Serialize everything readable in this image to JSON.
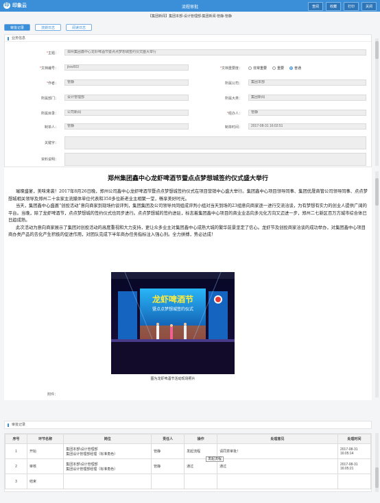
{
  "app": {
    "logo_text": "印象云",
    "logo_mark": "印",
    "window_title": "流程审批"
  },
  "top_actions": [
    "查阅",
    "收藏",
    "打印",
    "关闭"
  ],
  "doc_header": "【集团新闻】集团本部-设计管理部-集团新闻-管静-管静",
  "tabs": [
    "审批记录",
    "流转日志",
    "阅读日志"
  ],
  "business_info": {
    "title": "业务信息",
    "fields": {
      "subject_label": "主题：",
      "subject": "郑州集团鑫中心龙虾啤酒节暨点点梦想城签约仪式盛大举行",
      "doc_no_label": "文档编号：",
      "doc_no": "jtxw003",
      "importance_label": "文档重要度：",
      "importance_options": [
        "非常重要",
        "重要",
        "普通"
      ],
      "importance_selected": 2,
      "author_label": "作者：",
      "author": "管静",
      "company_label": "所属公司：",
      "company": "集团本部",
      "dept_label": "所属部门：",
      "dept": "设计管理部",
      "center_label": "所属大类：",
      "center": "集团新闻",
      "category_label": "所属目录：",
      "category": "公司新闻",
      "handler_label": "经办人：",
      "handler": "管静",
      "editor_label": "制单人：",
      "editor": "管静",
      "time_label": "制单时间：",
      "time": "2017-08-31 16:02:51",
      "keywords_label": "关键字：",
      "summary_label": "资料说明：",
      "attachment_label": "附件："
    }
  },
  "article": {
    "title": "郑州集团鑫中心龙虾啤酒节暨点点梦想城签约仪式盛大举行",
    "paragraphs": [
      "璀璨盛宴，美味来袭！2017年8月26日晚，郑州公司鑫中心龙虾啤酒节暨点点梦想城签约仪式在项目营销中心盛大举行。集团鑫中心项目领导同事、集团优晟商管公司领导同事、点点梦想城相关领导及郑州二十余家主流媒体单位代表和350多位新老业主相聚一堂，畅享美好时光。",
      "当天，集团鑫中心盛邀“创投活动”意向商家到现场约谈评判，集团集团及公司领导共同组成评判小组对当天到场的23组意向商家逐一进行交流洽谈，为有梦想有实力的创业人提供广阔的平台。当晚，除了龙虾啤酒节，点点梦想城的签约仪式也同步进行。点点梦想城的签约进驻，标志着集团鑫中心项目的商业业态向多元化方向又迈进一步，郑州二七新区百万方城市综合体已日趋成熟。",
      "此次活动为意向商家展示了集团对创投活动的高度重视和大力支持，更让众多业主对集团鑫中心成熟大城的繁华前景坚定了信心。龙虾节及创投商家洽谈的成功举办，对集团鑫中心项目商办类产品的去化产生积极的促进作用，对团队完成下半年商办任务指标注入强心剂。全力拼搏，势必达成！"
    ],
    "photo_sign": "龙虾啤酒节",
    "photo_sub": "暨点点梦想城签约仪式",
    "caption": "图为龙虾啤酒节活动现场照片"
  },
  "records": {
    "title": "审批记录",
    "columns": [
      "序号",
      "环节名称",
      "岗位",
      "责任人",
      "操作",
      "处理意见",
      "处理时间"
    ],
    "rows": [
      {
        "no": "1",
        "step": "开始",
        "post1": "集团本部\\设计管理部",
        "post2": "集团设计管理部经理（标准角色）",
        "person": "管静",
        "action": "发起流程",
        "opinion": "请同意审批！",
        "date": "2017-08-31",
        "time": "16:05:14"
      },
      {
        "no": "2",
        "step": "审核",
        "post1": "集团本部\\设计管理部",
        "post2": "集团设计管理部经理（标准角色）",
        "person": "管静",
        "action": "通过",
        "opinion": "通过",
        "date": "2017-08-31",
        "time": "16:05:21"
      },
      {
        "no": "3",
        "step": "结束",
        "post1": "",
        "post2": "",
        "person": "",
        "action": "",
        "opinion": "",
        "date": "",
        "time": ""
      }
    ],
    "tooltip": "发起流程"
  }
}
